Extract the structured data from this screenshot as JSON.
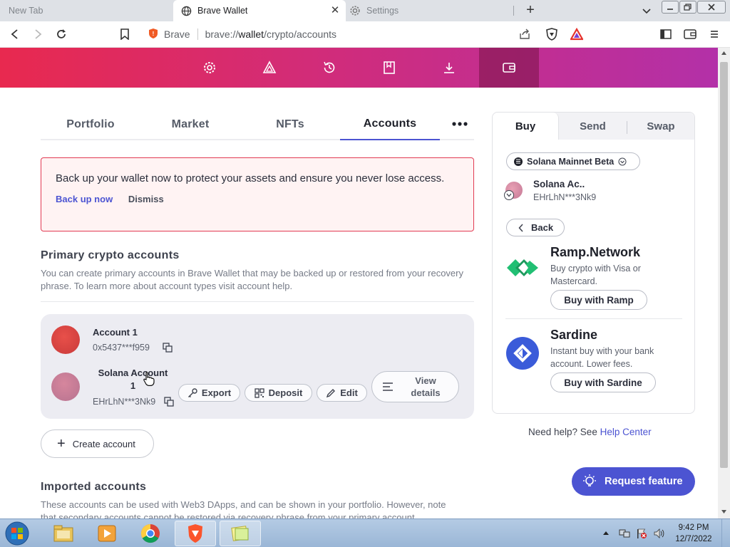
{
  "browser": {
    "tabs": [
      {
        "label": "New Tab"
      },
      {
        "label": "Brave Wallet"
      },
      {
        "label": "Settings"
      }
    ],
    "site": "Brave",
    "url_host": "brave://",
    "url_path": "wallet",
    "url_rest": "/crypto/accounts"
  },
  "nav": {
    "tabs": [
      "Portfolio",
      "Market",
      "NFTs",
      "Accounts"
    ]
  },
  "alert": {
    "message": "Back up your wallet now to protect your assets and ensure you never lose access.",
    "backup_label": "Back up now",
    "dismiss_label": "Dismiss"
  },
  "primary": {
    "title": "Primary crypto accounts",
    "description": "You can create primary accounts in Brave Wallet that may be backed up or restored from your recovery phrase. To learn more about account types visit account help."
  },
  "accounts": [
    {
      "name": "Account 1",
      "address": "0x5437***f959"
    },
    {
      "name_line1": "Solana Account",
      "name_line2": "1",
      "address": "EHrLhN***3Nk9"
    }
  ],
  "account_actions": {
    "export": "Export",
    "deposit": "Deposit",
    "edit": "Edit",
    "view_line1": "View",
    "view_line2": "details"
  },
  "create_account_label": "Create account",
  "imported": {
    "title": "Imported accounts",
    "description_line1": "These accounts can be used with Web3 DApps, and can be shown in your portfolio. However, note",
    "description_line2": "that secondary accounts cannot be restored via recovery phrase from your primary account"
  },
  "buy_panel": {
    "tabs": [
      "Buy",
      "Send",
      "Swap"
    ],
    "network": "Solana Mainnet Beta",
    "selected_account_name": "Solana Ac..",
    "selected_account_address": "EHrLhN***3Nk9",
    "back_label": "Back",
    "providers": [
      {
        "name": "Ramp.Network",
        "description": "Buy crypto with Visa or Mastercard.",
        "button": "Buy with Ramp"
      },
      {
        "name": "Sardine",
        "description": "Instant buy with your bank account. Lower fees.",
        "button": "Buy with Sardine"
      }
    ]
  },
  "help": {
    "prefix": "Need help? See ",
    "link": "Help Center"
  },
  "request_feature_label": "Request feature",
  "taskbar": {
    "time": "9:42 PM",
    "date": "12/7/2022"
  },
  "colors": {
    "accent": "#4c54d2",
    "header_start": "#e8294f",
    "header_end": "#b330a8",
    "alert_border": "#e23b53"
  }
}
